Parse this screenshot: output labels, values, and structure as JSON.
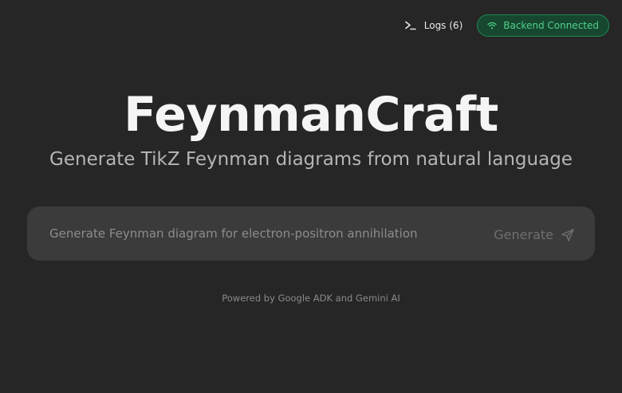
{
  "header": {
    "logs_label": "Logs (6)",
    "logs_icon": "terminal-icon",
    "status_label": "Backend Connected",
    "status_icon": "wifi-icon",
    "status_color": "#4fd18b"
  },
  "hero": {
    "title": "FeynmanCraft",
    "subtitle": "Generate TikZ Feynman diagrams from natural language"
  },
  "prompt": {
    "value": "",
    "placeholder": "Generate Feynman diagram for electron-positron annihilation",
    "generate_label": "Generate",
    "generate_icon": "send-icon"
  },
  "footer": {
    "text": "Powered by Google ADK and Gemini AI"
  }
}
